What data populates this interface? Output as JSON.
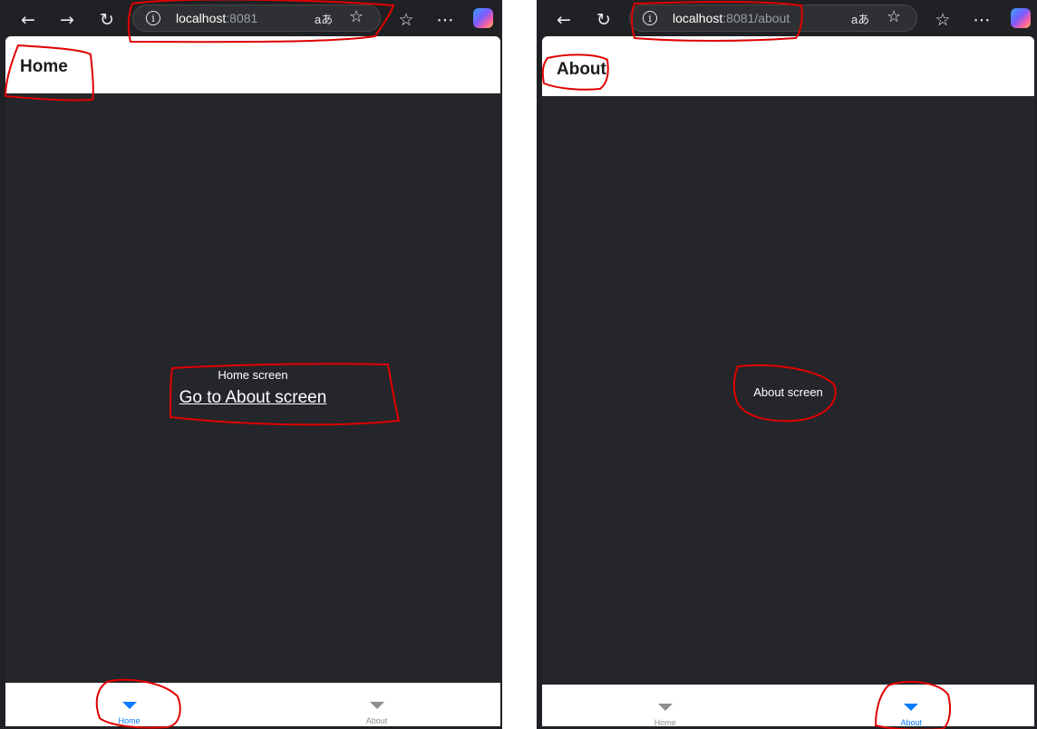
{
  "left": {
    "browser": {
      "url_host": "localhost",
      "url_rest": ":8081",
      "translate": "aあ"
    },
    "header": {
      "title": "Home"
    },
    "content": {
      "text": "Home screen",
      "link": "Go to About screen"
    },
    "tabs": [
      {
        "label": "Home",
        "active": true
      },
      {
        "label": "About",
        "active": false
      }
    ]
  },
  "right": {
    "browser": {
      "url_host": "localhost",
      "url_rest": ":8081/about",
      "translate": "aあ"
    },
    "header": {
      "title": "About"
    },
    "content": {
      "text": "About screen"
    },
    "tabs": [
      {
        "label": "Home",
        "active": false
      },
      {
        "label": "About",
        "active": true
      }
    ]
  },
  "colors": {
    "active_tab": "#0a7cff",
    "inactive_tab": "#8e8e93",
    "annotation": "#e00000",
    "content_bg": "#24262b"
  }
}
